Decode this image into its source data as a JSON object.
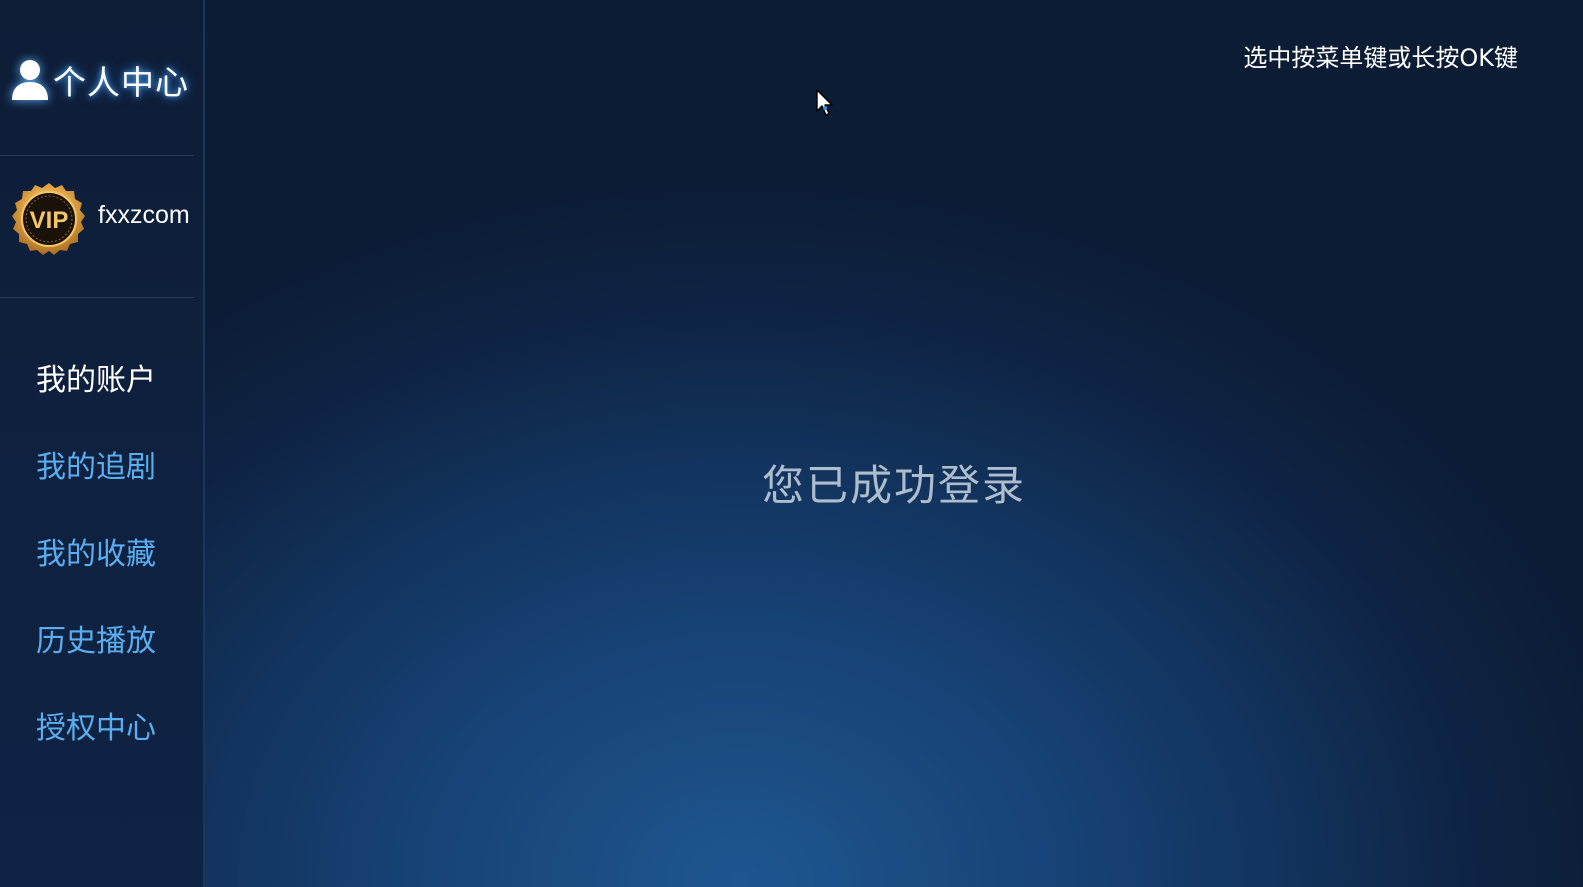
{
  "sidebar": {
    "header": {
      "icon": "user-icon",
      "title": "个人中心"
    },
    "profile": {
      "badge_text": "VIP",
      "badge_icon": "vip-badge-icon",
      "username": "fxxzcom"
    },
    "menu": [
      {
        "label": "我的账户",
        "active": true
      },
      {
        "label": "我的追剧",
        "active": false
      },
      {
        "label": "我的收藏",
        "active": false
      },
      {
        "label": "历史播放",
        "active": false
      },
      {
        "label": "授权中心",
        "active": false
      }
    ]
  },
  "main": {
    "hint": "选中按菜单键或长按OK键",
    "message": "您已成功登录"
  },
  "colors": {
    "menu_inactive": "#5aaef0",
    "menu_active": "#ffffff",
    "title_glow": "#58aefe",
    "badge_gold": "#e3a84a",
    "background_center": "#1f568f",
    "background_edge": "#0c1c35"
  },
  "cursor": {
    "icon": "mouse-pointer-icon"
  }
}
